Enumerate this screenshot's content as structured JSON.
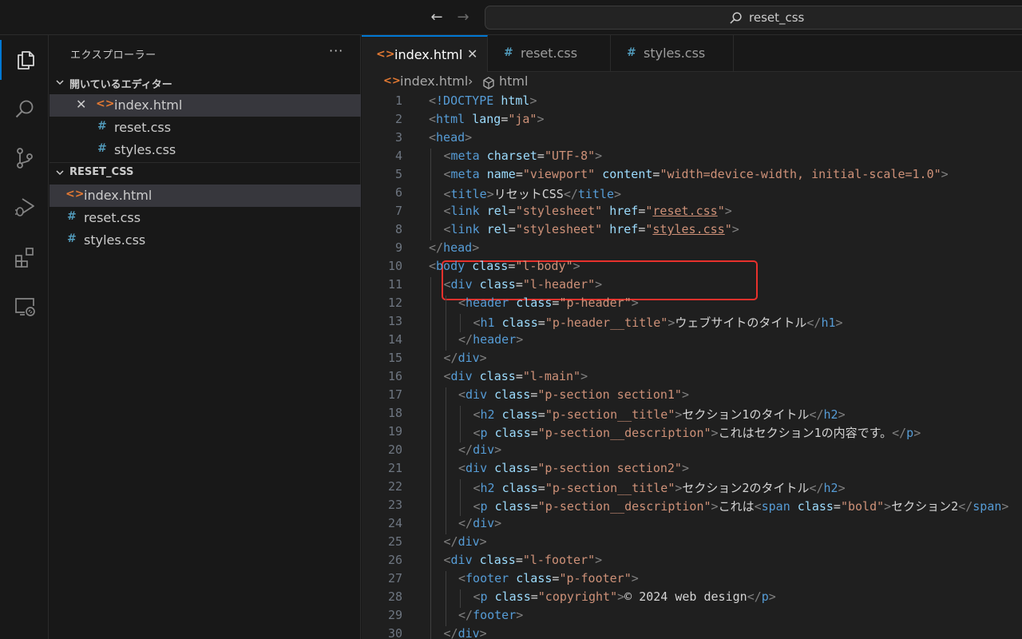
{
  "titlebar": {
    "back_glyph": "←",
    "forward_glyph": "→",
    "command_center_label": "reset_css",
    "search_icon": "search-icon"
  },
  "activity_bar": {
    "items": [
      {
        "name": "explorer",
        "icon": "files-icon",
        "active": true
      },
      {
        "name": "search",
        "icon": "search-icon",
        "active": false
      },
      {
        "name": "source-control",
        "icon": "source-control-icon",
        "active": false
      },
      {
        "name": "run-debug",
        "icon": "run-debug-icon",
        "active": false
      },
      {
        "name": "extensions",
        "icon": "extensions-icon",
        "active": false
      },
      {
        "name": "remote-explorer",
        "icon": "remote-explorer-icon",
        "active": false
      }
    ]
  },
  "sidebar": {
    "title": "エクスプローラー",
    "more_label": "···",
    "open_editors": {
      "label": "開いているエディター",
      "items": [
        {
          "name": "index.html",
          "type": "html",
          "icon_glyph": "<>",
          "close_glyph": "✕"
        },
        {
          "name": "reset.css",
          "type": "css",
          "icon_glyph": "#"
        },
        {
          "name": "styles.css",
          "type": "css",
          "icon_glyph": "#"
        }
      ]
    },
    "workspace": {
      "label": "RESET_CSS",
      "items": [
        {
          "name": "index.html",
          "type": "html",
          "icon_glyph": "<>"
        },
        {
          "name": "reset.css",
          "type": "css",
          "icon_glyph": "#"
        },
        {
          "name": "styles.css",
          "type": "css",
          "icon_glyph": "#"
        }
      ]
    }
  },
  "tabs": [
    {
      "label": "index.html",
      "icon_glyph": "<>",
      "close_glyph": "✕",
      "active": true
    },
    {
      "label": "reset.css",
      "icon_glyph": "#",
      "active": false
    },
    {
      "label": "styles.css",
      "icon_glyph": "#",
      "active": false
    }
  ],
  "breadcrumb": {
    "icon_glyph": "<>",
    "file": "index.html",
    "separator": "›",
    "element": "html"
  },
  "code_lines": [
    {
      "n": "1",
      "indent": 0,
      "tokens": [
        [
          "ang",
          "<"
        ],
        [
          "tag",
          "!DOCTYPE"
        ],
        [
          "txt",
          " "
        ],
        [
          "attr",
          "html"
        ],
        [
          "ang",
          ">"
        ]
      ]
    },
    {
      "n": "2",
      "indent": 0,
      "tokens": [
        [
          "ang",
          "<"
        ],
        [
          "tag",
          "html"
        ],
        [
          "txt",
          " "
        ],
        [
          "attr",
          "lang"
        ],
        [
          "txt",
          "="
        ],
        [
          "str",
          "\"ja\""
        ],
        [
          "ang",
          ">"
        ]
      ]
    },
    {
      "n": "3",
      "indent": 0,
      "tokens": [
        [
          "ang",
          "<"
        ],
        [
          "tag",
          "head"
        ],
        [
          "ang",
          ">"
        ]
      ]
    },
    {
      "n": "4",
      "indent": 1,
      "tokens": [
        [
          "ang",
          "<"
        ],
        [
          "tag",
          "meta"
        ],
        [
          "txt",
          " "
        ],
        [
          "attr",
          "charset"
        ],
        [
          "txt",
          "="
        ],
        [
          "str",
          "\"UTF-8\""
        ],
        [
          "ang",
          ">"
        ]
      ]
    },
    {
      "n": "5",
      "indent": 1,
      "tokens": [
        [
          "ang",
          "<"
        ],
        [
          "tag",
          "meta"
        ],
        [
          "txt",
          " "
        ],
        [
          "attr",
          "name"
        ],
        [
          "txt",
          "="
        ],
        [
          "str",
          "\"viewport\""
        ],
        [
          "txt",
          " "
        ],
        [
          "attr",
          "content"
        ],
        [
          "txt",
          "="
        ],
        [
          "str",
          "\"width=device-width, initial-scale=1.0\""
        ],
        [
          "ang",
          ">"
        ]
      ]
    },
    {
      "n": "6",
      "indent": 1,
      "tokens": [
        [
          "ang",
          "<"
        ],
        [
          "tag",
          "title"
        ],
        [
          "ang",
          ">"
        ],
        [
          "txt",
          "リセットCSS"
        ],
        [
          "ang",
          "</"
        ],
        [
          "tag",
          "title"
        ],
        [
          "ang",
          ">"
        ]
      ]
    },
    {
      "n": "7",
      "indent": 1,
      "tokens": [
        [
          "ang",
          "<"
        ],
        [
          "tag",
          "link"
        ],
        [
          "txt",
          " "
        ],
        [
          "attr",
          "rel"
        ],
        [
          "txt",
          "="
        ],
        [
          "str",
          "\"stylesheet\""
        ],
        [
          "txt",
          " "
        ],
        [
          "attr",
          "href"
        ],
        [
          "txt",
          "="
        ],
        [
          "str",
          "\""
        ],
        [
          "link",
          "reset.css"
        ],
        [
          "str",
          "\""
        ],
        [
          "ang",
          ">"
        ]
      ]
    },
    {
      "n": "8",
      "indent": 1,
      "tokens": [
        [
          "ang",
          "<"
        ],
        [
          "tag",
          "link"
        ],
        [
          "txt",
          " "
        ],
        [
          "attr",
          "rel"
        ],
        [
          "txt",
          "="
        ],
        [
          "str",
          "\"stylesheet\""
        ],
        [
          "txt",
          " "
        ],
        [
          "attr",
          "href"
        ],
        [
          "txt",
          "="
        ],
        [
          "str",
          "\""
        ],
        [
          "link",
          "styles.css"
        ],
        [
          "str",
          "\""
        ],
        [
          "ang",
          ">"
        ]
      ]
    },
    {
      "n": "9",
      "indent": 0,
      "tokens": [
        [
          "ang",
          "</"
        ],
        [
          "tag",
          "head"
        ],
        [
          "ang",
          ">"
        ]
      ]
    },
    {
      "n": "10",
      "indent": 0,
      "tokens": [
        [
          "ang",
          "<"
        ],
        [
          "tag",
          "body"
        ],
        [
          "txt",
          " "
        ],
        [
          "attr",
          "class"
        ],
        [
          "txt",
          "="
        ],
        [
          "str",
          "\"l-body\""
        ],
        [
          "ang",
          ">"
        ]
      ]
    },
    {
      "n": "11",
      "indent": 1,
      "tokens": [
        [
          "ang",
          "<"
        ],
        [
          "tag",
          "div"
        ],
        [
          "txt",
          " "
        ],
        [
          "attr",
          "class"
        ],
        [
          "txt",
          "="
        ],
        [
          "str",
          "\"l-header\""
        ],
        [
          "ang",
          ">"
        ]
      ]
    },
    {
      "n": "12",
      "indent": 2,
      "tokens": [
        [
          "ang",
          "<"
        ],
        [
          "tag",
          "header"
        ],
        [
          "txt",
          " "
        ],
        [
          "attr",
          "class"
        ],
        [
          "txt",
          "="
        ],
        [
          "str",
          "\"p-header\""
        ],
        [
          "ang",
          ">"
        ]
      ]
    },
    {
      "n": "13",
      "indent": 3,
      "tokens": [
        [
          "ang",
          "<"
        ],
        [
          "tag",
          "h1"
        ],
        [
          "txt",
          " "
        ],
        [
          "attr",
          "class"
        ],
        [
          "txt",
          "="
        ],
        [
          "str",
          "\"p-header__title\""
        ],
        [
          "ang",
          ">"
        ],
        [
          "txt",
          "ウェブサイトのタイトル"
        ],
        [
          "ang",
          "</"
        ],
        [
          "tag",
          "h1"
        ],
        [
          "ang",
          ">"
        ]
      ]
    },
    {
      "n": "14",
      "indent": 2,
      "tokens": [
        [
          "ang",
          "</"
        ],
        [
          "tag",
          "header"
        ],
        [
          "ang",
          ">"
        ]
      ]
    },
    {
      "n": "15",
      "indent": 1,
      "tokens": [
        [
          "ang",
          "</"
        ],
        [
          "tag",
          "div"
        ],
        [
          "ang",
          ">"
        ]
      ]
    },
    {
      "n": "16",
      "indent": 1,
      "tokens": [
        [
          "ang",
          "<"
        ],
        [
          "tag",
          "div"
        ],
        [
          "txt",
          " "
        ],
        [
          "attr",
          "class"
        ],
        [
          "txt",
          "="
        ],
        [
          "str",
          "\"l-main\""
        ],
        [
          "ang",
          ">"
        ]
      ]
    },
    {
      "n": "17",
      "indent": 2,
      "tokens": [
        [
          "ang",
          "<"
        ],
        [
          "tag",
          "div"
        ],
        [
          "txt",
          " "
        ],
        [
          "attr",
          "class"
        ],
        [
          "txt",
          "="
        ],
        [
          "str",
          "\"p-section section1\""
        ],
        [
          "ang",
          ">"
        ]
      ]
    },
    {
      "n": "18",
      "indent": 3,
      "tokens": [
        [
          "ang",
          "<"
        ],
        [
          "tag",
          "h2"
        ],
        [
          "txt",
          " "
        ],
        [
          "attr",
          "class"
        ],
        [
          "txt",
          "="
        ],
        [
          "str",
          "\"p-section__title\""
        ],
        [
          "ang",
          ">"
        ],
        [
          "txt",
          "セクション1のタイトル"
        ],
        [
          "ang",
          "</"
        ],
        [
          "tag",
          "h2"
        ],
        [
          "ang",
          ">"
        ]
      ]
    },
    {
      "n": "19",
      "indent": 3,
      "tokens": [
        [
          "ang",
          "<"
        ],
        [
          "tag",
          "p"
        ],
        [
          "txt",
          " "
        ],
        [
          "attr",
          "class"
        ],
        [
          "txt",
          "="
        ],
        [
          "str",
          "\"p-section__description\""
        ],
        [
          "ang",
          ">"
        ],
        [
          "txt",
          "これはセクション1の内容です。"
        ],
        [
          "ang",
          "</"
        ],
        [
          "tag",
          "p"
        ],
        [
          "ang",
          ">"
        ]
      ]
    },
    {
      "n": "20",
      "indent": 2,
      "tokens": [
        [
          "ang",
          "</"
        ],
        [
          "tag",
          "div"
        ],
        [
          "ang",
          ">"
        ]
      ]
    },
    {
      "n": "21",
      "indent": 2,
      "tokens": [
        [
          "ang",
          "<"
        ],
        [
          "tag",
          "div"
        ],
        [
          "txt",
          " "
        ],
        [
          "attr",
          "class"
        ],
        [
          "txt",
          "="
        ],
        [
          "str",
          "\"p-section section2\""
        ],
        [
          "ang",
          ">"
        ]
      ]
    },
    {
      "n": "22",
      "indent": 3,
      "tokens": [
        [
          "ang",
          "<"
        ],
        [
          "tag",
          "h2"
        ],
        [
          "txt",
          " "
        ],
        [
          "attr",
          "class"
        ],
        [
          "txt",
          "="
        ],
        [
          "str",
          "\"p-section__title\""
        ],
        [
          "ang",
          ">"
        ],
        [
          "txt",
          "セクション2のタイトル"
        ],
        [
          "ang",
          "</"
        ],
        [
          "tag",
          "h2"
        ],
        [
          "ang",
          ">"
        ]
      ]
    },
    {
      "n": "23",
      "indent": 3,
      "tokens": [
        [
          "ang",
          "<"
        ],
        [
          "tag",
          "p"
        ],
        [
          "txt",
          " "
        ],
        [
          "attr",
          "class"
        ],
        [
          "txt",
          "="
        ],
        [
          "str",
          "\"p-section__description\""
        ],
        [
          "ang",
          ">"
        ],
        [
          "txt",
          "これは"
        ],
        [
          "ang",
          "<"
        ],
        [
          "tag",
          "span"
        ],
        [
          "txt",
          " "
        ],
        [
          "attr",
          "class"
        ],
        [
          "txt",
          "="
        ],
        [
          "str",
          "\"bold\""
        ],
        [
          "ang",
          ">"
        ],
        [
          "txt",
          "セクション2"
        ],
        [
          "ang",
          "</"
        ],
        [
          "tag",
          "span"
        ],
        [
          "ang",
          ">"
        ]
      ]
    },
    {
      "n": "24",
      "indent": 2,
      "tokens": [
        [
          "ang",
          "</"
        ],
        [
          "tag",
          "div"
        ],
        [
          "ang",
          ">"
        ]
      ]
    },
    {
      "n": "25",
      "indent": 1,
      "tokens": [
        [
          "ang",
          "</"
        ],
        [
          "tag",
          "div"
        ],
        [
          "ang",
          ">"
        ]
      ]
    },
    {
      "n": "26",
      "indent": 1,
      "tokens": [
        [
          "ang",
          "<"
        ],
        [
          "tag",
          "div"
        ],
        [
          "txt",
          " "
        ],
        [
          "attr",
          "class"
        ],
        [
          "txt",
          "="
        ],
        [
          "str",
          "\"l-footer\""
        ],
        [
          "ang",
          ">"
        ]
      ]
    },
    {
      "n": "27",
      "indent": 2,
      "tokens": [
        [
          "ang",
          "<"
        ],
        [
          "tag",
          "footer"
        ],
        [
          "txt",
          " "
        ],
        [
          "attr",
          "class"
        ],
        [
          "txt",
          "="
        ],
        [
          "str",
          "\"p-footer\""
        ],
        [
          "ang",
          ">"
        ]
      ]
    },
    {
      "n": "28",
      "indent": 3,
      "tokens": [
        [
          "ang",
          "<"
        ],
        [
          "tag",
          "p"
        ],
        [
          "txt",
          " "
        ],
        [
          "attr",
          "class"
        ],
        [
          "txt",
          "="
        ],
        [
          "str",
          "\"copyright\""
        ],
        [
          "ang",
          ">"
        ],
        [
          "txt",
          "© 2024 web design"
        ],
        [
          "ang",
          "</"
        ],
        [
          "tag",
          "p"
        ],
        [
          "ang",
          ">"
        ]
      ]
    },
    {
      "n": "29",
      "indent": 2,
      "tokens": [
        [
          "ang",
          "</"
        ],
        [
          "tag",
          "footer"
        ],
        [
          "ang",
          ">"
        ]
      ]
    },
    {
      "n": "30",
      "indent": 1,
      "tokens": [
        [
          "ang",
          "</"
        ],
        [
          "tag",
          "div"
        ],
        [
          "ang",
          ">"
        ]
      ]
    }
  ],
  "highlight": {
    "lines": [
      "7",
      "8"
    ],
    "color": "#e8312c"
  },
  "colors": {
    "accent": "#0078d4",
    "html_icon": "#e37933",
    "css_icon": "#519aba",
    "tag": "#569cd6",
    "attr": "#9cdcfe",
    "string": "#ce9178"
  }
}
